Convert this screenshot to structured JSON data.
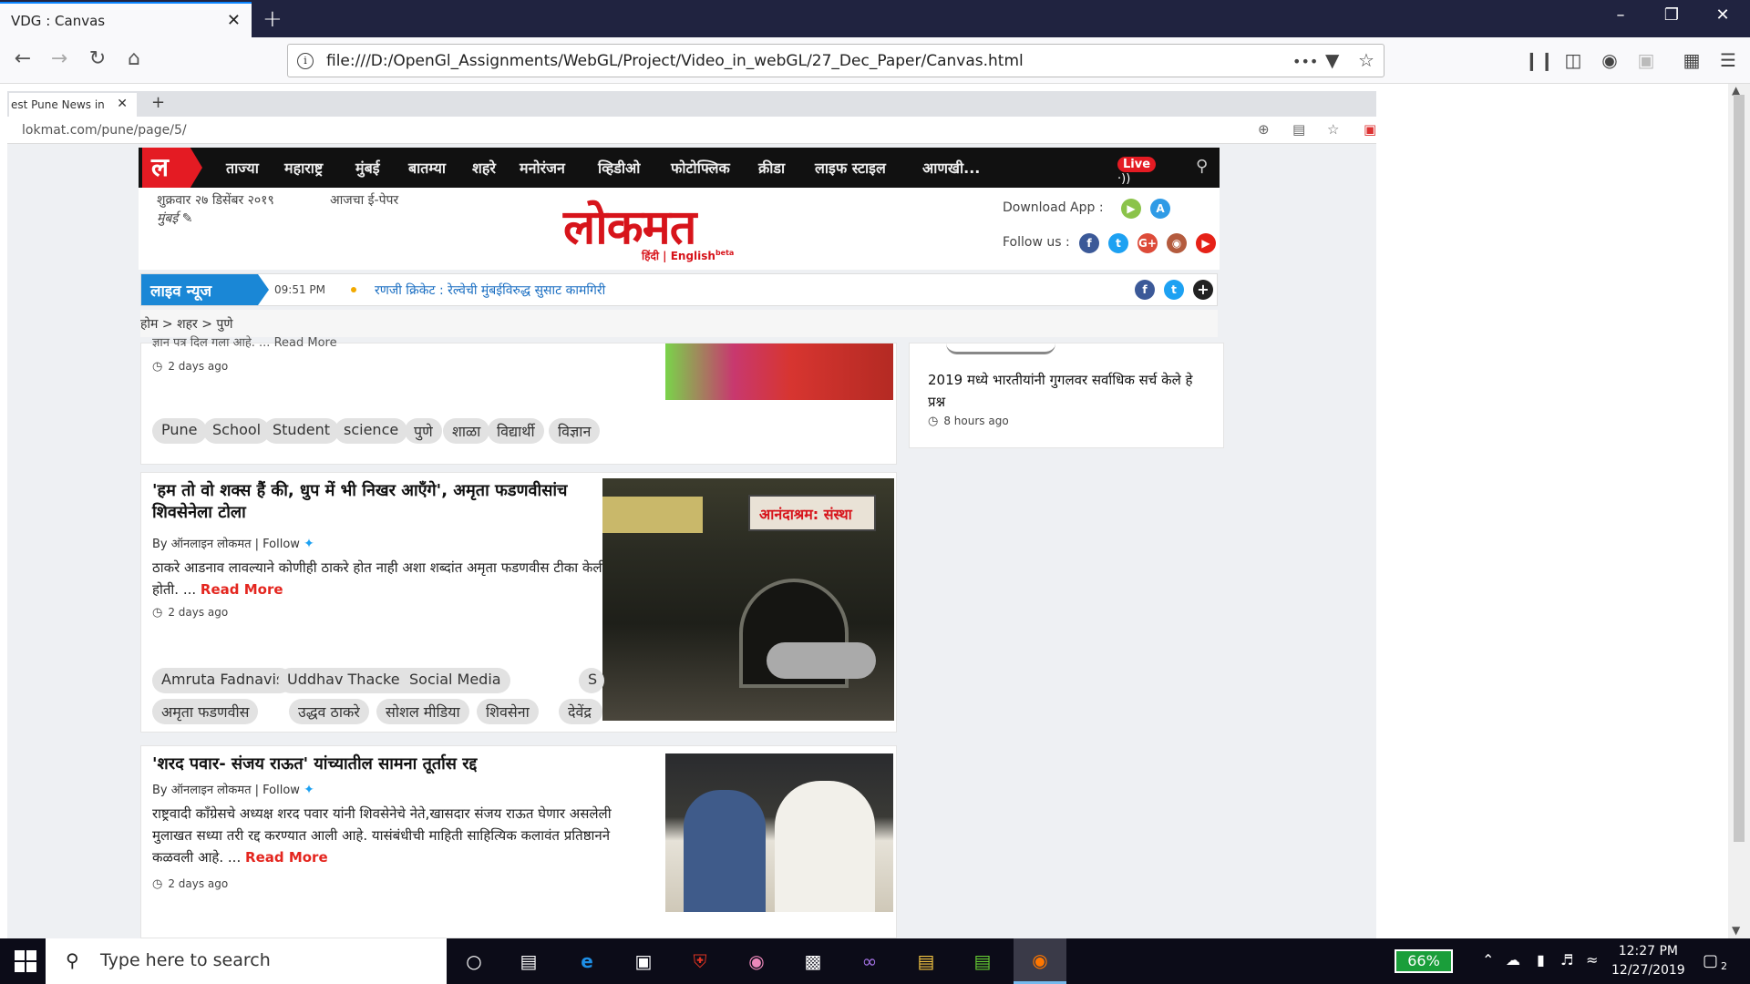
{
  "browser": {
    "tab_title": "VDG : Canvas",
    "tab_close": "✕",
    "new_tab": "+",
    "url": "file:///D:/OpenGl_Assignments/WebGL/Project/Video_in_webGL/27_Dec_Paper/Canvas.html",
    "more": "•••",
    "window_minimize": "–",
    "window_restore": "❐",
    "window_close": "✕"
  },
  "inner_browser": {
    "tab_title": "est Pune News in",
    "tab_close": "✕",
    "new_tab": "+",
    "url": "lokmat.com/pune/page/5/"
  },
  "lokmat": {
    "logo": "ल",
    "nav_items": [
      "ताज्या",
      "महाराष्ट्र",
      "मुंबई",
      "बातम्या",
      "शहरे",
      "मनोरंजन",
      "व्हिडीओ",
      "फोटोफ्लिक",
      "क्रीडा",
      "लाइफ स्टाइल",
      "आणखी..."
    ],
    "live_badge": "Live",
    "date": "शुक्रवार २७ डिसेंबर २०१९",
    "epaper": "आजचा ई-पेपर",
    "city": "मुंबई ✎",
    "masthead": "लोकमत",
    "languages": "हिंदी | English",
    "beta": "beta",
    "download_app": "Download App :",
    "follow_us": "Follow us :",
    "live_label": "लाइव न्यूज",
    "live_time": "09:51 PM",
    "live_text": "रणजी क्रिकेट : रेल्वेची मुंबईविरुद्ध सुसाट कामगिरी",
    "breadcrumb": "होम > शहर > पुणे"
  },
  "article_top": {
    "partial_desc": "ज्ञान पत्र दिल गला आहे. ... Read More",
    "ago": "2 days ago",
    "tags": [
      "Pune",
      "School",
      "Student",
      "science",
      "पुणे",
      "शाळा",
      "विद्यार्थी",
      "विज्ञान"
    ]
  },
  "side_card": {
    "headline": "2019 मध्ये भारतीयांनी गुगलवर सर्वाधिक सर्च केले हे प्रश्न",
    "ago": "8 hours ago"
  },
  "article_2": {
    "headline": "'हम तो वो शक्स हैं की, धुप में भी निखर आएँगे', अमृता फडणवीसांच शिवसेनेला टोला",
    "byline": "By ऑनलाइन लोकमत | Follow",
    "desc": "ठाकरे आडनाव लावल्याने कोणीही ठाकरे होत नाही अशा शब्दांत अमृता फडणवीस टीका केली होती. ...",
    "read_more": "Read More",
    "ago": "2 days ago",
    "tags_row1": [
      "Amruta Fadnavis",
      "Uddhav Thackeray",
      "Social Media",
      "S"
    ],
    "tags_row2": [
      "अमृता फडणवीस",
      "उद्धव ठाकरे",
      "सोशल मीडिया",
      "शिवसेना",
      "देवेंद्र"
    ],
    "photo_sign": "आनंदाश्रम: संस्था"
  },
  "article_3": {
    "headline": "'शरद पवार- संजय राऊत' यांच्यातील सामना तूर्तास रद्द",
    "byline": "By ऑनलाइन लोकमत | Follow",
    "desc": "राष्ट्रवादी काँग्रेसचे अध्यक्ष शरद पवार यांनी शिवसेनेचे नेते,खासदार संजय राऊत घेणार असलेली मुलाखत सध्या तरी रद्द करण्यात आली आहे. यासंबंधीची माहिती साहित्यिक कलावंत प्रतिष्ठानने कळवली आहे. ...",
    "read_more": "Read More",
    "ago": "2 days ago"
  },
  "taskbar": {
    "search_placeholder": "Type here to search",
    "battery": "66%",
    "time": "12:27 PM",
    "date": "12/27/2019",
    "notifications": "2"
  },
  "colors": {
    "lokmat_red": "#d7141b",
    "live_blue": "#1a87d6",
    "tabstrip": "#202340"
  }
}
